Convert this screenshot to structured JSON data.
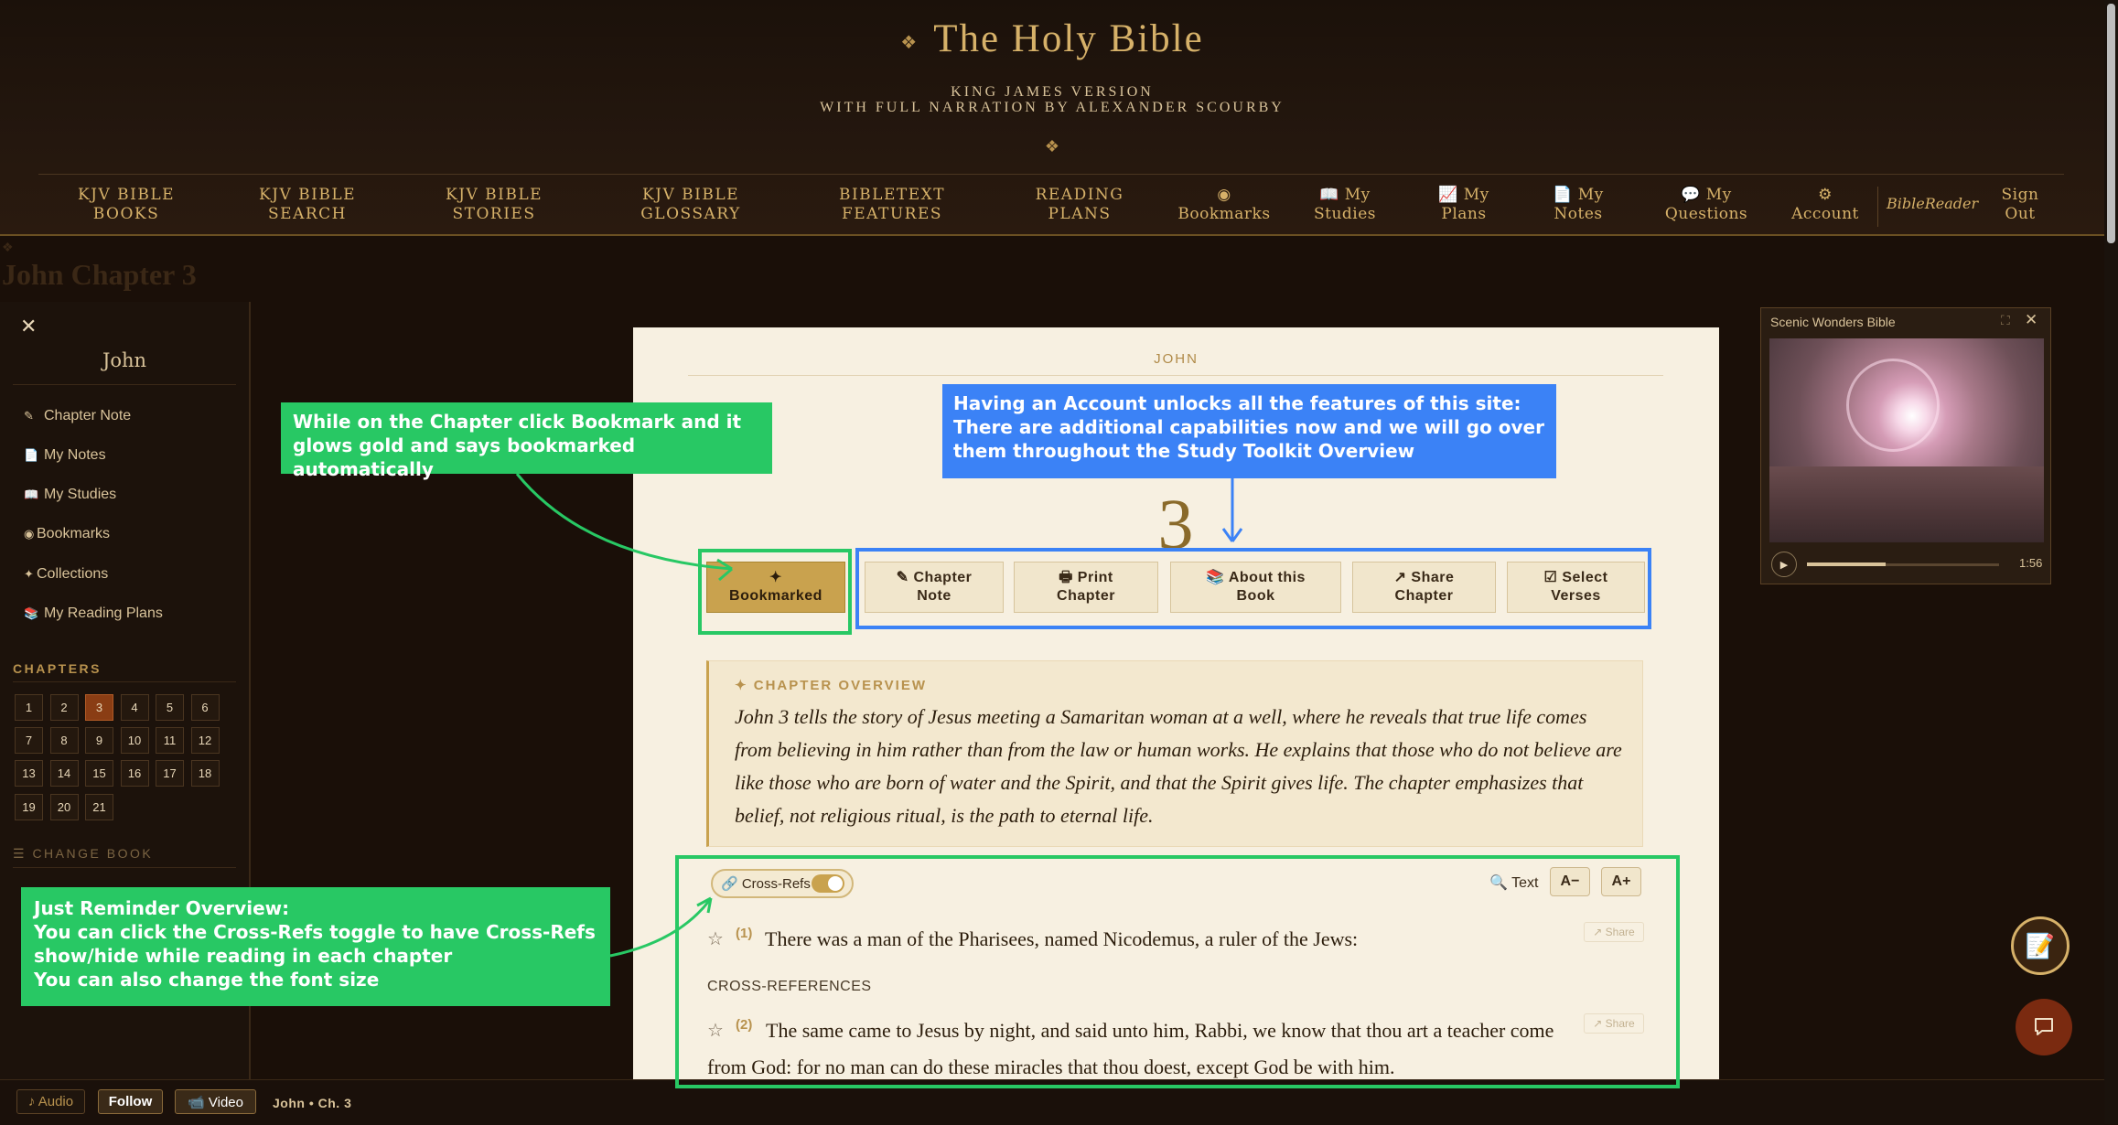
{
  "header": {
    "title_ornament": "❖",
    "title": "The Holy Bible",
    "subtitle_line1": "KING JAMES VERSION",
    "subtitle_line2": "WITH FULL NARRATION BY ALEXANDER SCOURBY",
    "ornament": "❖"
  },
  "nav": {
    "kjv_books": [
      "KJV BIBLE",
      "BOOKS"
    ],
    "kjv_search": [
      "KJV BIBLE",
      "SEARCH"
    ],
    "kjv_stories": [
      "KJV BIBLE",
      "STORIES"
    ],
    "kjv_glossary": [
      "KJV BIBLE",
      "GLOSSARY"
    ],
    "bibletext_features": [
      "BIBLETEXT",
      "FEATURES"
    ],
    "reading_plans": [
      "READING",
      "PLANS"
    ],
    "bookmarks": [
      "◉",
      "Bookmarks"
    ],
    "my_studies": [
      "📖 My",
      "Studies"
    ],
    "my_plans": [
      "📈 My",
      "Plans"
    ],
    "my_notes": [
      "📄 My",
      "Notes"
    ],
    "my_questions": [
      "💬 My",
      "Questions"
    ],
    "account": [
      "⚙",
      "Account"
    ],
    "bible_reader": "BibleReader",
    "sign_out": [
      "Sign",
      "Out"
    ]
  },
  "background_title": "John Chapter 3",
  "background_title_mark": "❖",
  "sidebar": {
    "close": "✕",
    "book": "John",
    "items": [
      {
        "icon": "✎",
        "label": "Chapter Note"
      },
      {
        "icon": "📄",
        "label": "My Notes"
      },
      {
        "icon": "📖",
        "label": "My Studies"
      },
      {
        "icon": "◉",
        "label": "Bookmarks"
      },
      {
        "icon": "✦",
        "label": "Collections"
      },
      {
        "icon": "📚",
        "label": "My Reading Plans"
      }
    ],
    "chapters_label": "CHAPTERS",
    "chapters": [
      "1",
      "2",
      "3",
      "4",
      "5",
      "6",
      "7",
      "8",
      "9",
      "10",
      "11",
      "12",
      "13",
      "14",
      "15",
      "16",
      "17",
      "18",
      "19",
      "20",
      "21"
    ],
    "active_chapter": "3",
    "change_book": "☰ CHANGE BOOK"
  },
  "page": {
    "book_label": "JOHN",
    "chapter_number": "3",
    "toolbar": {
      "bookmarked": [
        "✦",
        "Bookmarked"
      ],
      "chapter_note": [
        "✎ Chapter",
        "Note"
      ],
      "print_chapter": [
        "🖶 Print",
        "Chapter"
      ],
      "about_book": [
        "📚 About this",
        "Book"
      ],
      "share_chapter": [
        "↗ Share",
        "Chapter"
      ],
      "select_verses": [
        "☑ Select",
        "Verses"
      ]
    },
    "overview_label": "✦ CHAPTER OVERVIEW",
    "overview_text": "John 3 tells the story of Jesus meeting a Samaritan woman at a well, where he reveals that true life comes from believing in him rather than from the law or human works. He explains that those who do not believe are like those who are born of water and the Spirit, and that the Spirit gives life. The chapter emphasizes that belief, not religious ritual, is the path to eternal life.",
    "crossrefs_toggle": "🔗 Cross-Refs",
    "crossrefs_on": true,
    "text_search": "🔍 Text",
    "font_decrease": "A−",
    "font_increase": "A+",
    "verses": [
      {
        "star": "☆",
        "num": "(1)",
        "text": "There was a man of the Pharisees, named Nicodemus, a ruler of the Jews:",
        "share": "↗ Share"
      },
      {
        "star": "☆",
        "num": "(2)",
        "text": "The same came to Jesus by night, and said unto him, Rabbi, we know that thou art a teacher come from God: for no man can do these miracles that thou doest, except God be with him.",
        "share": "↗ Share"
      }
    ],
    "crossrefs_heading": "CROSS-REFERENCES"
  },
  "video": {
    "title": "Scenic Wonders Bible",
    "expand": "⛶",
    "close": "✕",
    "play": "▶",
    "time": "1:56",
    "progress": 0.41
  },
  "floating": {
    "notes_icon": "📝"
  },
  "bottom_bar": {
    "audio": "♪ Audio",
    "follow": "Follow",
    "video": "📹 Video",
    "status": "John • Ch. 3"
  },
  "annotations": {
    "bookmark_tip": [
      "While on the Chapter click Bookmark and it",
      "glows gold and says bookmarked automatically"
    ],
    "account_tip": [
      "Having an Account unlocks all the features of this site:",
      "There are additional capabilities now and we will go over",
      "them throughout the Study Toolkit Overview"
    ],
    "reminder_tip": [
      "Just Reminder Overview:",
      "You can click the Cross-Refs toggle to have Cross-Refs",
      "show/hide while reading in each chapter",
      "You can also change the font size"
    ]
  },
  "colors": {
    "gold": "#c9a24e",
    "parchment": "#f7f0e1",
    "dark_bg": "#1a0f08",
    "annotation_green": "#28c864",
    "annotation_blue": "#3b82f6",
    "active_chapter": "#8a3d14"
  }
}
